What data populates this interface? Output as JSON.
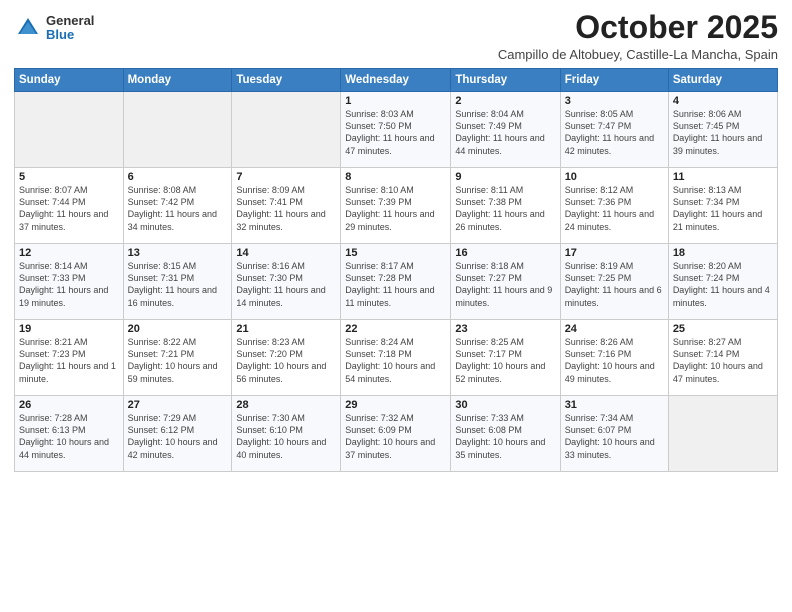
{
  "logo": {
    "general": "General",
    "blue": "Blue"
  },
  "title": "October 2025",
  "subtitle": "Campillo de Altobuey, Castille-La Mancha, Spain",
  "days_of_week": [
    "Sunday",
    "Monday",
    "Tuesday",
    "Wednesday",
    "Thursday",
    "Friday",
    "Saturday"
  ],
  "weeks": [
    [
      {
        "day": "",
        "info": ""
      },
      {
        "day": "",
        "info": ""
      },
      {
        "day": "",
        "info": ""
      },
      {
        "day": "1",
        "info": "Sunrise: 8:03 AM\nSunset: 7:50 PM\nDaylight: 11 hours and 47 minutes."
      },
      {
        "day": "2",
        "info": "Sunrise: 8:04 AM\nSunset: 7:49 PM\nDaylight: 11 hours and 44 minutes."
      },
      {
        "day": "3",
        "info": "Sunrise: 8:05 AM\nSunset: 7:47 PM\nDaylight: 11 hours and 42 minutes."
      },
      {
        "day": "4",
        "info": "Sunrise: 8:06 AM\nSunset: 7:45 PM\nDaylight: 11 hours and 39 minutes."
      }
    ],
    [
      {
        "day": "5",
        "info": "Sunrise: 8:07 AM\nSunset: 7:44 PM\nDaylight: 11 hours and 37 minutes."
      },
      {
        "day": "6",
        "info": "Sunrise: 8:08 AM\nSunset: 7:42 PM\nDaylight: 11 hours and 34 minutes."
      },
      {
        "day": "7",
        "info": "Sunrise: 8:09 AM\nSunset: 7:41 PM\nDaylight: 11 hours and 32 minutes."
      },
      {
        "day": "8",
        "info": "Sunrise: 8:10 AM\nSunset: 7:39 PM\nDaylight: 11 hours and 29 minutes."
      },
      {
        "day": "9",
        "info": "Sunrise: 8:11 AM\nSunset: 7:38 PM\nDaylight: 11 hours and 26 minutes."
      },
      {
        "day": "10",
        "info": "Sunrise: 8:12 AM\nSunset: 7:36 PM\nDaylight: 11 hours and 24 minutes."
      },
      {
        "day": "11",
        "info": "Sunrise: 8:13 AM\nSunset: 7:34 PM\nDaylight: 11 hours and 21 minutes."
      }
    ],
    [
      {
        "day": "12",
        "info": "Sunrise: 8:14 AM\nSunset: 7:33 PM\nDaylight: 11 hours and 19 minutes."
      },
      {
        "day": "13",
        "info": "Sunrise: 8:15 AM\nSunset: 7:31 PM\nDaylight: 11 hours and 16 minutes."
      },
      {
        "day": "14",
        "info": "Sunrise: 8:16 AM\nSunset: 7:30 PM\nDaylight: 11 hours and 14 minutes."
      },
      {
        "day": "15",
        "info": "Sunrise: 8:17 AM\nSunset: 7:28 PM\nDaylight: 11 hours and 11 minutes."
      },
      {
        "day": "16",
        "info": "Sunrise: 8:18 AM\nSunset: 7:27 PM\nDaylight: 11 hours and 9 minutes."
      },
      {
        "day": "17",
        "info": "Sunrise: 8:19 AM\nSunset: 7:25 PM\nDaylight: 11 hours and 6 minutes."
      },
      {
        "day": "18",
        "info": "Sunrise: 8:20 AM\nSunset: 7:24 PM\nDaylight: 11 hours and 4 minutes."
      }
    ],
    [
      {
        "day": "19",
        "info": "Sunrise: 8:21 AM\nSunset: 7:23 PM\nDaylight: 11 hours and 1 minute."
      },
      {
        "day": "20",
        "info": "Sunrise: 8:22 AM\nSunset: 7:21 PM\nDaylight: 10 hours and 59 minutes."
      },
      {
        "day": "21",
        "info": "Sunrise: 8:23 AM\nSunset: 7:20 PM\nDaylight: 10 hours and 56 minutes."
      },
      {
        "day": "22",
        "info": "Sunrise: 8:24 AM\nSunset: 7:18 PM\nDaylight: 10 hours and 54 minutes."
      },
      {
        "day": "23",
        "info": "Sunrise: 8:25 AM\nSunset: 7:17 PM\nDaylight: 10 hours and 52 minutes."
      },
      {
        "day": "24",
        "info": "Sunrise: 8:26 AM\nSunset: 7:16 PM\nDaylight: 10 hours and 49 minutes."
      },
      {
        "day": "25",
        "info": "Sunrise: 8:27 AM\nSunset: 7:14 PM\nDaylight: 10 hours and 47 minutes."
      }
    ],
    [
      {
        "day": "26",
        "info": "Sunrise: 7:28 AM\nSunset: 6:13 PM\nDaylight: 10 hours and 44 minutes."
      },
      {
        "day": "27",
        "info": "Sunrise: 7:29 AM\nSunset: 6:12 PM\nDaylight: 10 hours and 42 minutes."
      },
      {
        "day": "28",
        "info": "Sunrise: 7:30 AM\nSunset: 6:10 PM\nDaylight: 10 hours and 40 minutes."
      },
      {
        "day": "29",
        "info": "Sunrise: 7:32 AM\nSunset: 6:09 PM\nDaylight: 10 hours and 37 minutes."
      },
      {
        "day": "30",
        "info": "Sunrise: 7:33 AM\nSunset: 6:08 PM\nDaylight: 10 hours and 35 minutes."
      },
      {
        "day": "31",
        "info": "Sunrise: 7:34 AM\nSunset: 6:07 PM\nDaylight: 10 hours and 33 minutes."
      },
      {
        "day": "",
        "info": ""
      }
    ]
  ]
}
